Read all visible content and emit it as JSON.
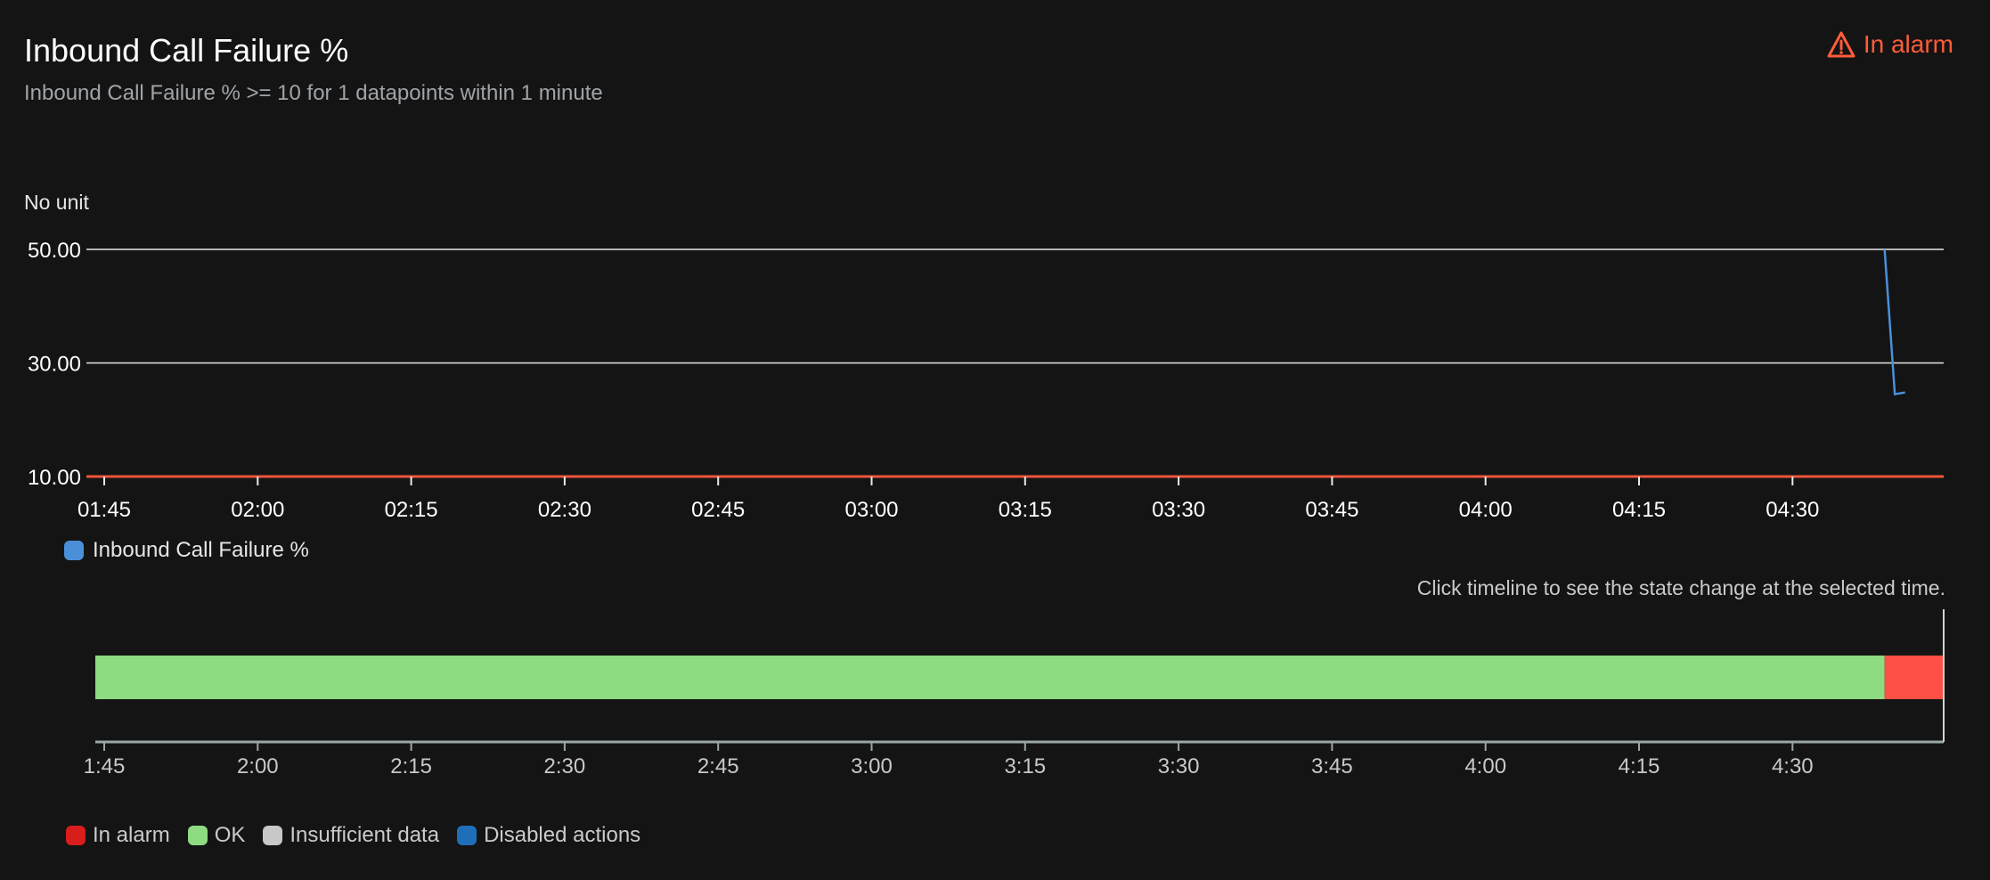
{
  "header": {
    "title": "Inbound Call Failure %",
    "subtitle": "Inbound Call Failure % >= 10 for 1 datapoints within 1 minute",
    "status_label": "In alarm",
    "status_icon": "warning-triangle-icon",
    "status_color": "#ff5d3a"
  },
  "chart_data": [
    {
      "type": "line",
      "ylabel": "No unit",
      "yticks": [
        "50.00",
        "30.00",
        "10.00"
      ],
      "ylim": [
        10,
        50
      ],
      "grid": true,
      "xticks": [
        "01:45",
        "02:00",
        "02:15",
        "02:30",
        "02:45",
        "03:00",
        "03:15",
        "03:30",
        "03:45",
        "04:00",
        "04:15",
        "04:30"
      ],
      "threshold": {
        "value": 10,
        "color": "#f0553a"
      },
      "series": [
        {
          "name": "Inbound Call Failure %",
          "color": "#4a90d9",
          "points": [
            [
              "04:39",
              50
            ],
            [
              "04:40",
              24.5
            ],
            [
              "04:41",
              24.8
            ]
          ]
        }
      ],
      "legend_position": "bottom-left"
    },
    {
      "type": "timeline",
      "hint": "Click timeline to see the state change at the selected time.",
      "xticks": [
        "1:45",
        "2:00",
        "2:15",
        "2:30",
        "2:45",
        "3:00",
        "3:15",
        "3:30",
        "3:45",
        "4:00",
        "4:15",
        "4:30"
      ],
      "segments": [
        {
          "state": "OK",
          "from": "1:45",
          "to": "4:39",
          "color": "#8fdb81"
        },
        {
          "state": "In alarm",
          "from": "4:39",
          "to": "4:45",
          "color": "#ff5045"
        }
      ],
      "legend": [
        {
          "label": "In alarm",
          "color": "#d91c1c"
        },
        {
          "label": "OK",
          "color": "#8fdb81"
        },
        {
          "label": "Insufficient data",
          "color": "#c8c8c8"
        },
        {
          "label": "Disabled actions",
          "color": "#1f6fb8"
        }
      ]
    }
  ]
}
